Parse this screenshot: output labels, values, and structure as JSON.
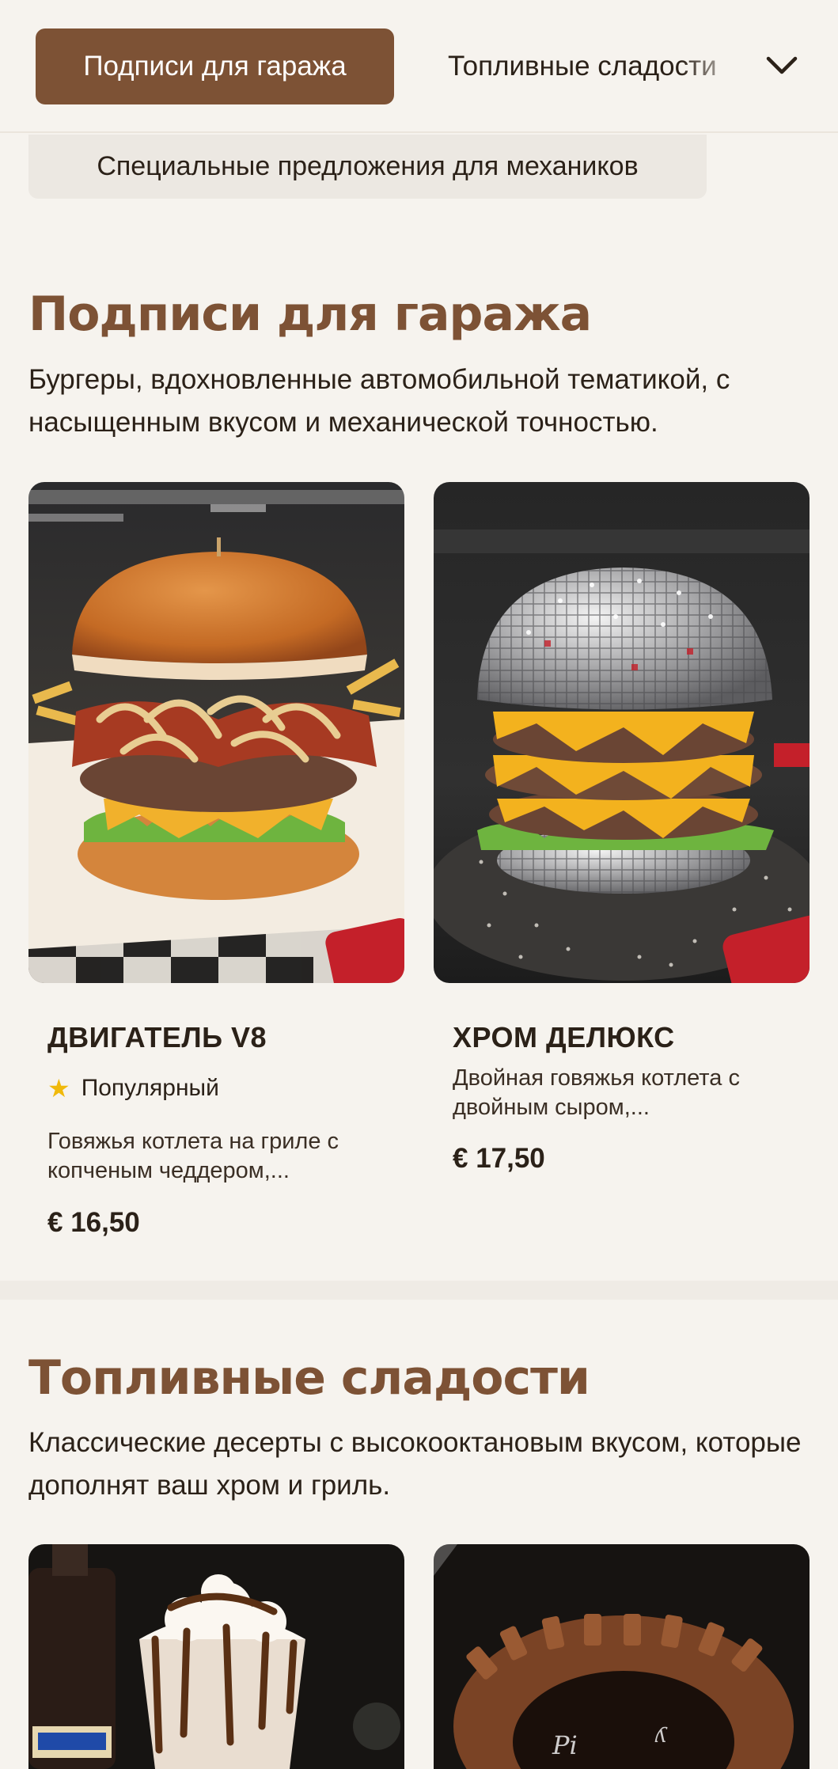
{
  "nav": {
    "tabs": [
      {
        "label": "Подписи для гаража"
      },
      {
        "label": "Топливные сладости"
      },
      {
        "label": "Специальные предложения для механиков"
      }
    ]
  },
  "sections": [
    {
      "title": "Подписи для гаража",
      "description": "Бургеры, вдохновленные автомобильной тематикой, с насыщенным вкусом и механической точностью.",
      "items": [
        {
          "name": "ДВИГАТЕЛЬ V8",
          "badge": "Популярный",
          "description": "Говяжья котлета на гриле с копченым чеддером,...",
          "price": "€ 16,50"
        },
        {
          "name": "ХРОМ ДЕЛЮКС",
          "description": "Двойная говяжья котлета с двойным сыром,...",
          "price": "€ 17,50"
        }
      ]
    },
    {
      "title": "Топливные сладости",
      "description": "Классические десерты с высокооктановым вкусом, которые дополнят ваш хром и гриль."
    }
  ],
  "icons": {
    "chevron": "chevron-down-icon",
    "star": "star-icon"
  },
  "colors": {
    "accent": "#7d5235",
    "background": "#f6f3ee",
    "star": "#f0b90b"
  }
}
